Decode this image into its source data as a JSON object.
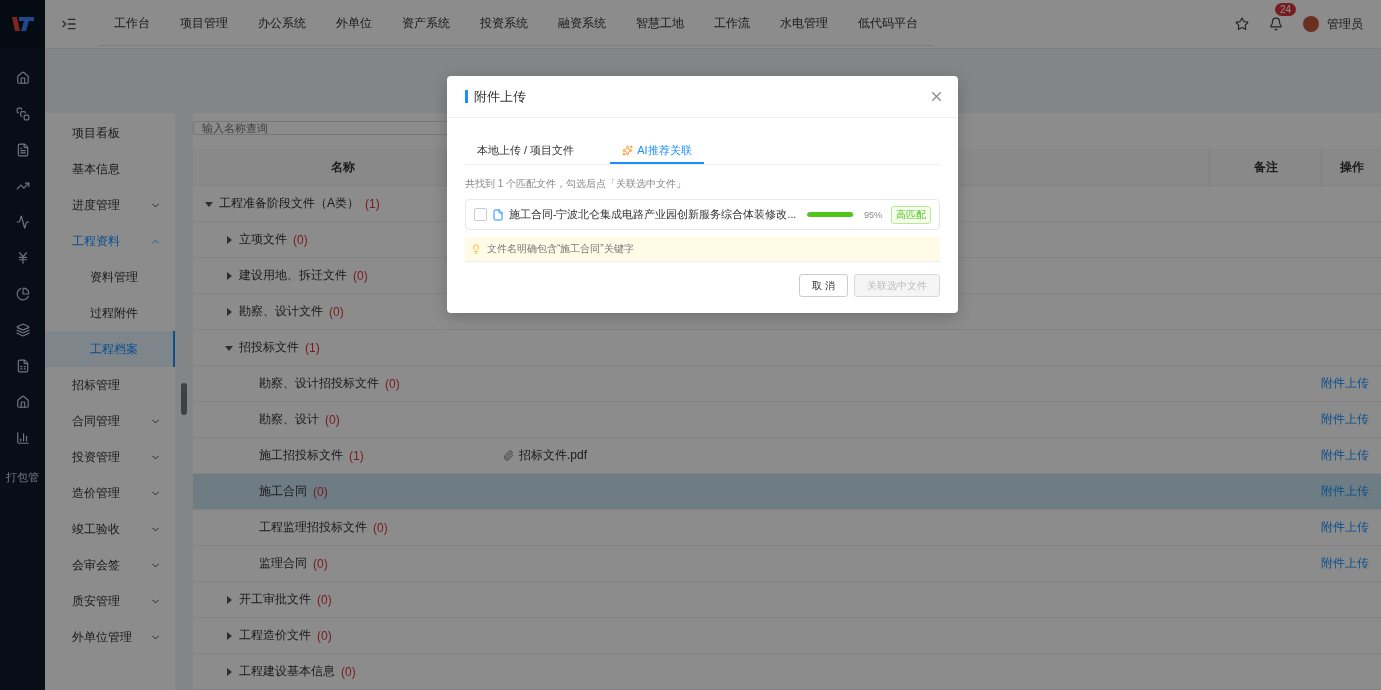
{
  "icon_bar": {
    "label": "打包管"
  },
  "top_nav": {
    "items": [
      "工作台",
      "项目管理",
      "办公系统",
      "外单位",
      "资产系统",
      "投资系统",
      "融资系统",
      "智慧工地",
      "工作流",
      "水电管理",
      "低代码平台"
    ],
    "notification_count": "24",
    "user": "管理员"
  },
  "side_nav": [
    {
      "label": "项目看板",
      "selected": false
    },
    {
      "label": "基本信息",
      "selected": false
    },
    {
      "label": "进度管理",
      "selected": false,
      "expanded": false
    },
    {
      "label": "工程资料",
      "selected": true,
      "expanded": true,
      "children": [
        {
          "label": "资料管理",
          "selected": false
        },
        {
          "label": "过程附件",
          "selected": false
        },
        {
          "label": "工程档案",
          "selected": true
        }
      ]
    },
    {
      "label": "招标管理",
      "selected": false
    },
    {
      "label": "合同管理",
      "selected": false,
      "expanded": false
    },
    {
      "label": "投资管理",
      "selected": false,
      "expanded": false
    },
    {
      "label": "造价管理",
      "selected": false,
      "expanded": false
    },
    {
      "label": "竣工验收",
      "selected": false,
      "expanded": false
    },
    {
      "label": "会审会签",
      "selected": false,
      "expanded": false
    },
    {
      "label": "质安管理",
      "selected": false,
      "expanded": false
    },
    {
      "label": "外单位管理",
      "selected": false,
      "expanded": false
    }
  ],
  "search": {
    "placeholder": "输入名称查询"
  },
  "table": {
    "columns": [
      "名称",
      "备注",
      "操作"
    ],
    "rows": [
      {
        "label": "工程准备阶段文件（A类）",
        "count": "(1)",
        "expanded": true,
        "selected": false,
        "children": [
          {
            "label": "立项文件",
            "count": "(0)",
            "expanded": false,
            "selected": false
          },
          {
            "label": "建设用地、拆迁文件",
            "count": "(0)",
            "expanded": false,
            "selected": false
          },
          {
            "label": "勘察、设计文件",
            "count": "(0)",
            "expanded": false,
            "selected": false
          },
          {
            "label": "招投标文件",
            "count": "(1)",
            "expanded": true,
            "selected": false,
            "children": [
              {
                "label": "勘察、设计招投标文件",
                "count": "(0)",
                "selected": false,
                "action": "附件上传"
              },
              {
                "label": "勘察、设计",
                "count": "(0)",
                "selected": false,
                "action": "附件上传"
              },
              {
                "label": "施工招投标文件",
                "count": "(1)",
                "selected": false,
                "attachment": "招标文件.pdf",
                "action": "附件上传"
              },
              {
                "label": "施工合同",
                "count": "(0)",
                "selected": true,
                "action": "附件上传"
              },
              {
                "label": "工程监理招投标文件",
                "count": "(0)",
                "selected": false,
                "action": "附件上传"
              },
              {
                "label": "监理合同",
                "count": "(0)",
                "selected": false,
                "action": "附件上传"
              }
            ]
          },
          {
            "label": "开工审批文件",
            "count": "(0)",
            "expanded": false,
            "selected": false
          },
          {
            "label": "工程造价文件",
            "count": "(0)",
            "expanded": false,
            "selected": false
          },
          {
            "label": "工程建设基本信息",
            "count": "(0)",
            "expanded": false,
            "selected": false
          }
        ]
      }
    ]
  },
  "dialog": {
    "title": "附件上传",
    "tabs": [
      {
        "label": "本地上传 / 项目文件",
        "selected": false,
        "kind": "plain"
      },
      {
        "label": "AI推荐关联",
        "selected": true,
        "kind": "ai"
      }
    ],
    "summary": "共找到 1 个匹配文件，勾选后点「关联选中文件」",
    "files": [
      {
        "name": "施工合同-宁波北仑集成电路产业园创新服务综合体装修改...",
        "checked": false,
        "level": 0.95,
        "reading": "95%",
        "tag": "高匹配"
      }
    ],
    "tip": "文件名明确包含“施工合同”关键字",
    "buttons": [
      {
        "label": "取 消",
        "disabled": false,
        "kind": "default"
      },
      {
        "label": "关联选中文件",
        "disabled": true,
        "kind": "primary"
      }
    ]
  }
}
